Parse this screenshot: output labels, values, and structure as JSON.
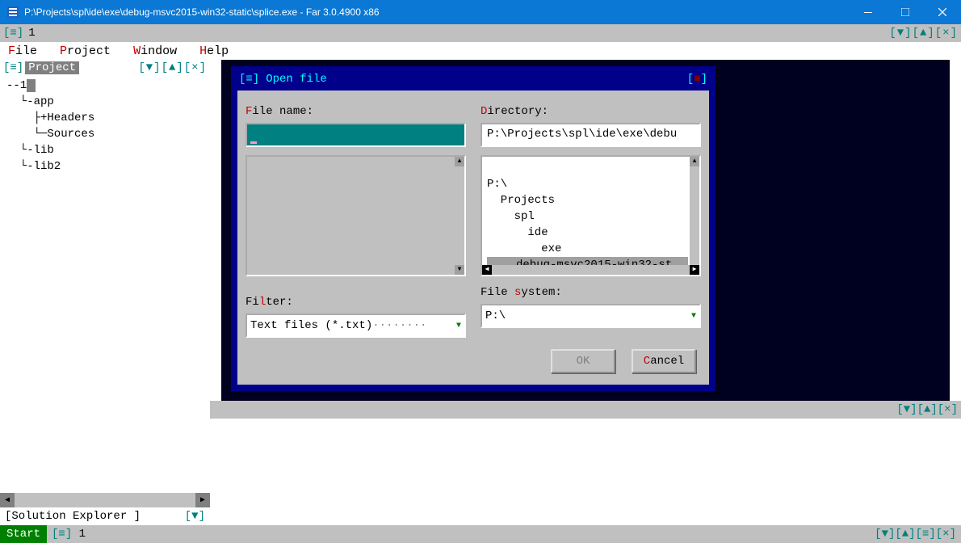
{
  "window": {
    "title": "P:\\Projects\\spl\\ide\\exe\\debug-msvc2015-win32-static\\splice.exe - Far 3.0.4900 x86"
  },
  "top_strip": {
    "sys": "[≡]",
    "num": "1",
    "controls": "[▼][▲][×]"
  },
  "menu": {
    "file_hot": "F",
    "file": "ile",
    "project_hot": "P",
    "project": "roject",
    "window_hot": "W",
    "window": "indow",
    "help_hot": "H",
    "help": "elp"
  },
  "project_pane": {
    "sys": "[≡]",
    "title": "Project",
    "controls": "[▼][▲][×]",
    "tree_lines": {
      "l0": "--1",
      "l1": "  └-app",
      "l2": "    ├+Headers",
      "l3": "    └─Sources",
      "l4": "  └-lib",
      "l5": "  └-lib2"
    },
    "footer": "[Solution Explorer       ]",
    "footer_dd": "[▼]"
  },
  "right_strip_controls": "[▼][▲][×]",
  "dialog": {
    "sys": "[≡]",
    "title": "Open file",
    "close": "[ ]",
    "filename_label_hot": "F",
    "filename_label": "ile name:",
    "directory_label_hot": "D",
    "directory_label": "irectory:",
    "directory_value": "P:\\Projects\\spl\\ide\\exe\\debu",
    "dir_tree": {
      "d0": "P:\\",
      "d1": "  Projects",
      "d2": "    spl",
      "d3": "      ide",
      "d4": "        exe",
      "d5": "debug-msvc2015-win32-st"
    },
    "filter_label_pre": "Fi",
    "filter_label_hot": "l",
    "filter_label_post": "ter:",
    "filter_value": "Text files (*.txt)",
    "filter_dots": "········",
    "filesystem_label_pre": "File ",
    "filesystem_label_hot": "s",
    "filesystem_label_post": "ystem:",
    "filesystem_value": "P:\\",
    "ok": "OK",
    "cancel_hot": "C",
    "cancel": "ancel"
  },
  "status": {
    "start": "Start",
    "sys": "[≡]",
    "num": "1",
    "right": "[▼][▲][≡][×]"
  }
}
